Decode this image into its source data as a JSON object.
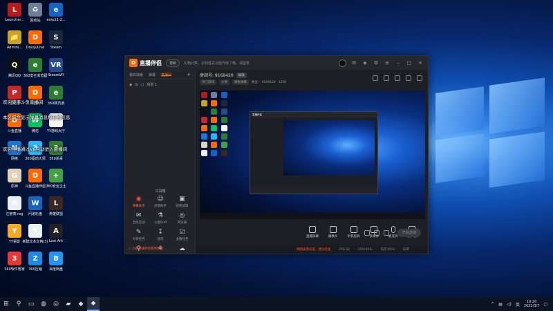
{
  "desktop": {
    "icons": [
      {
        "label": "Launcher...",
        "color": "#b71c1c",
        "glyph": "L"
      },
      {
        "label": "回收站",
        "color": "#6e7f99",
        "glyph": "♻"
      },
      {
        "label": "emp11-2...",
        "color": "#1565c0",
        "glyph": "e"
      },
      {
        "label": "Admini...",
        "color": "#c9a227",
        "glyph": "📁"
      },
      {
        "label": "DouyuLive",
        "color": "#ff6a00",
        "glyph": "D"
      },
      {
        "label": "Steam",
        "color": "#1b2838",
        "glyph": "S"
      },
      {
        "label": "腾讯QQ",
        "color": "#111",
        "glyph": "Q"
      },
      {
        "label": "360安全浏览器",
        "color": "#2e7d32",
        "glyph": "e"
      },
      {
        "label": "SteamVR",
        "color": "#264a8a",
        "glyph": "VR"
      },
      {
        "label": "在线游",
        "color": "#c62828",
        "glyph": "P"
      },
      {
        "label": "斗鱼大",
        "color": "#ff6a00",
        "glyph": "D"
      },
      {
        "label": "360网页游",
        "color": "#2e7d32",
        "glyph": "e"
      },
      {
        "label": "斗鱼直播",
        "color": "#ff6a00",
        "glyph": "D"
      },
      {
        "label": "微信",
        "color": "#07c160",
        "glyph": "W"
      },
      {
        "label": "YY游戏大厅",
        "color": "#f5f5f5",
        "glyph": "Y"
      },
      {
        "label": "网络",
        "color": "#1976d2",
        "glyph": "N"
      },
      {
        "label": "360驱动大师",
        "color": "#29b6f6",
        "glyph": "3"
      },
      {
        "label": "360杀毒",
        "color": "#2e7d32",
        "glyph": "3"
      },
      {
        "label": "原神",
        "color": "#e0d3b8",
        "glyph": "G"
      },
      {
        "label": "斗鱼直播伴侣",
        "color": "#ff6a00",
        "glyph": "D"
      },
      {
        "label": "360安全卫士",
        "color": "#43a047",
        "glyph": "+"
      },
      {
        "label": "注册表.reg",
        "color": "#eceff1",
        "glyph": "R"
      },
      {
        "label": "问道轮盘",
        "color": "#1565c0",
        "glyph": "W"
      },
      {
        "label": "英雄联盟",
        "color": "#3e2723",
        "glyph": "L"
      },
      {
        "label": "YY语音",
        "color": "#f9a825",
        "glyph": "Y"
      },
      {
        "label": "新建文本文档(3)",
        "color": "#eceff1",
        "glyph": "T"
      },
      {
        "label": "Lost Ark",
        "color": "#222",
        "glyph": "A"
      },
      {
        "label": "360软件管家",
        "color": "#e53935",
        "glyph": "3"
      },
      {
        "label": "360压缩",
        "color": "#1e88e5",
        "glyph": "Z"
      },
      {
        "label": "百度网盘",
        "color": "#2196f3",
        "glyph": "B"
      }
    ],
    "overlays": [
      "欢迎使用斗鱼直播间",
      "本区域会显示弹幕消息和礼物信息",
      "欢迎主播通过V6自动进入直播间"
    ]
  },
  "window": {
    "app_name": "直播伴侣",
    "version_pill": "更新",
    "notice": "礼物计算，识别首充功能升级了哦，请留意",
    "tabs": [
      "我的场景",
      "弹幕",
      "直播间"
    ],
    "active_tab": 2,
    "scene_label": "场景 1",
    "toolbox_title": "工具箱",
    "tools": [
      {
        "label": "弹幕助手",
        "hot": true,
        "glyph": "◉"
      },
      {
        "label": "房管助手",
        "hot": false,
        "glyph": "☺"
      },
      {
        "label": "视频滤镜",
        "hot": false,
        "glyph": "▣"
      },
      {
        "label": "全民互动",
        "hot": false,
        "glyph": "✉"
      },
      {
        "label": "斗鱼Buff",
        "hot": false,
        "glyph": "⚗"
      },
      {
        "label": "浏览器",
        "hot": false,
        "glyph": "◎"
      },
      {
        "label": "礼物任务",
        "hot": false,
        "glyph": "✎"
      },
      {
        "label": "语音",
        "hot": false,
        "glyph": "↧"
      },
      {
        "label": "主播任务",
        "hot": false,
        "glyph": "☑"
      },
      {
        "label": "",
        "hot": false,
        "glyph": "⚲"
      },
      {
        "label": "",
        "hot": false,
        "glyph": "⚘"
      },
      {
        "label": "",
        "hot": false,
        "glyph": "☁"
      }
    ],
    "bottom_tip": "斗鱼直播伴侣使用教程"
  },
  "room": {
    "title": "房间号: 9169420",
    "edit_pill": "编辑",
    "tag1": "热门游戏",
    "tag2": "大神",
    "tag3": "模板弹幕",
    "fans_label": "粉丝:",
    "fans": "9169420",
    "followers": "4256"
  },
  "controls": [
    {
      "label": "直播屏幕",
      "icon": "screen-icon"
    },
    {
      "label": "摄像头",
      "icon": "camera-icon"
    },
    {
      "label": "手机投屏",
      "icon": "phone-icon"
    },
    {
      "label": "多媒体",
      "icon": "media-icon"
    },
    {
      "label": "麦克风",
      "icon": "mic-icon"
    },
    {
      "label": "扬声器",
      "icon": "speaker-icon"
    }
  ],
  "start_live": "开始直播",
  "status": {
    "warn": "网络质量较差，建议检查",
    "fps": "FPS:32",
    "cpu": "CPU:65%",
    "mem": "内存:85%",
    "rate": "码率"
  },
  "taskbar": {
    "time": "10:20",
    "date": "2022/3/7",
    "ime": "英"
  }
}
